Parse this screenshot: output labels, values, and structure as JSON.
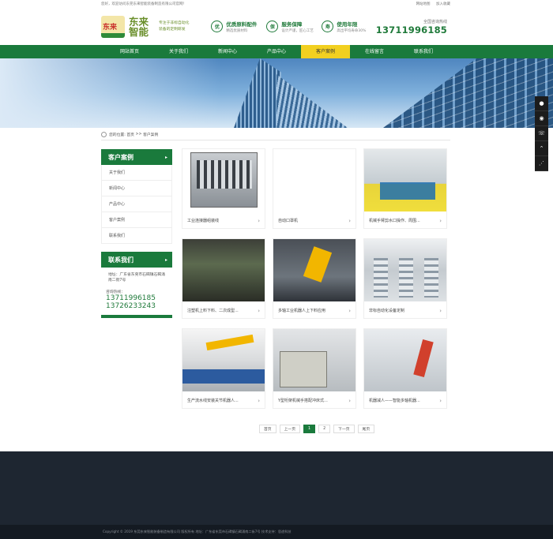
{
  "topbar": {
    "welcome": "您好，欢迎访问东莞东来智能装备制造有限公司官网！",
    "links": [
      "网站地图",
      "加入收藏"
    ]
  },
  "logo": {
    "mark_text": "东来",
    "title": "东来智能",
    "slogan_line1": "专注于非标自动化",
    "slogan_line2": "装备的定制研发"
  },
  "features": [
    {
      "icon": "优",
      "title": "优质原料配件",
      "sub": "精选优质材料"
    },
    {
      "icon": "保",
      "title": "服务保障",
      "sub": "设计严谨，匠心工艺"
    },
    {
      "icon": "寿",
      "title": "使用年限",
      "sub": "高出平均寿命30%"
    }
  ],
  "hotline": {
    "label": "全国咨询热线",
    "number": "13711996185"
  },
  "nav": {
    "items": [
      "网站首页",
      "关于我们",
      "新闻中心",
      "产品中心",
      "客户案例",
      "在线留言",
      "联系我们"
    ],
    "active_index": 4
  },
  "side_tools": [
    "qq",
    "wechat",
    "phone",
    "top",
    "share"
  ],
  "breadcrumb": {
    "prefix": "您的位置:",
    "home": "首页",
    "sep": ">>",
    "current": "客户案例"
  },
  "sidebar": {
    "title": "客户案例",
    "items": [
      "关于我们",
      "新闻中心",
      "产品中心",
      "客户案例",
      "联系我们"
    ],
    "contact_title": "联系我们",
    "address": "地址：广东省东莞市石碣镇石碣涌南二街7号",
    "tel_label": "咨询热线：",
    "tels": [
      "13711996185",
      "13726233243"
    ]
  },
  "cases": [
    {
      "title": "工业连接器组装线"
    },
    {
      "title": "自动口罩机"
    },
    {
      "title": "机械手臂剪水口操作、周围..."
    },
    {
      "title": "注塑机上料下料、二次成型..."
    },
    {
      "title": "多轴工业机器人上下料应用"
    },
    {
      "title": "非标自动化设备定制"
    },
    {
      "title": "生产流水线安装关节机器人..."
    },
    {
      "title": "Y型桁架机械手搭配冲床式..."
    },
    {
      "title": "机器减人——智能多轴机器..."
    }
  ],
  "pager": {
    "first": "首页",
    "prev": "上一页",
    "pages": [
      "1",
      "2"
    ],
    "current": "1",
    "next": "下一页",
    "last": "尾页"
  },
  "footer": {
    "copyright": "Copyright © 2019 东莞东来智能装备制造有限公司 版权所有    地址：广东省东莞市石碣镇石碣涌南二街7号    技术支持：思途科技"
  },
  "colors": {
    "brand_green": "#1a7a3c",
    "nav_active": "#f2d020",
    "footer_bg": "#1e2631"
  }
}
